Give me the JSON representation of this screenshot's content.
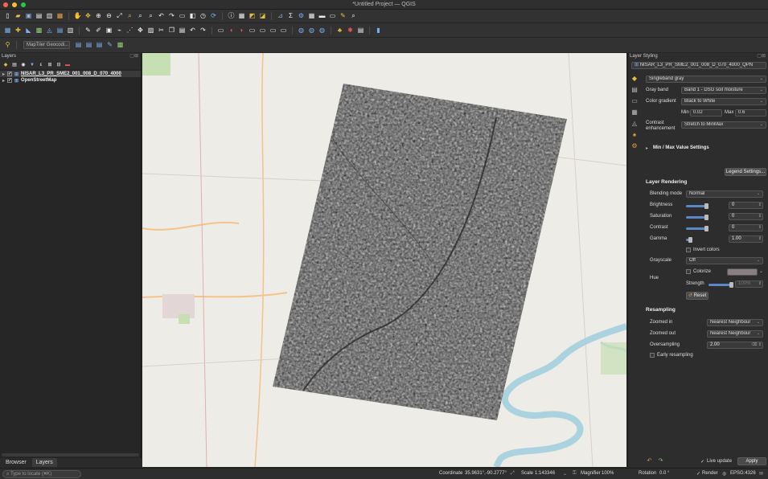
{
  "window": {
    "title": "*Untitled Project — QGIS"
  },
  "toolbar": {
    "geocoder_label": "MapTiler Geocodi..."
  },
  "layers_panel": {
    "title": "Layers",
    "items": [
      {
        "name": "NISAR_L3_PR_SME2_001_008_D_070_4000",
        "checked": "✓"
      },
      {
        "name": "OpenStreetMap",
        "checked": "✓"
      }
    ]
  },
  "bottom_tabs": [
    "Browser",
    "Layers"
  ],
  "styling": {
    "title": "Layer Styling",
    "layer_select": "NISAR_L3_PR_SME2_001_008_D_070_4000_QPN",
    "renderer": "Singleband gray",
    "gray_band_label": "Gray band",
    "gray_band_value": "Band 1 - DSG soil moisture",
    "color_gradient_label": "Color gradient",
    "color_gradient_value": "Black to White",
    "min_label": "Min",
    "min_value": "0.02",
    "max_label": "Max",
    "max_value": "0.6",
    "contrast_label_1": "Contrast",
    "contrast_label_2": "enhancement",
    "contrast_value": "Stretch to MinMax",
    "minmax_settings": "Min / Max Value Settings",
    "legend_settings": "Legend Settings...",
    "layer_rendering": "Layer Rendering",
    "blending_label": "Blending mode",
    "blending_value": "Normal",
    "brightness_label": "Brightness",
    "brightness_value": "0",
    "brightness_level": 0.5,
    "saturation_label": "Saturation",
    "saturation_value": "0",
    "saturation_level": 0.5,
    "contrast2_label": "Contrast",
    "contrast2_value": "0",
    "contrast2_level": 0.5,
    "gamma_label": "Gamma",
    "gamma_value": "1.00",
    "gamma_level": 0.1,
    "invert_label": "Invert colors",
    "grayscale_label": "Grayscale",
    "grayscale_value": "Off",
    "hue_label": "Hue",
    "colorize_label": "Colorize",
    "strength_label": "Strength",
    "strength_value": "100%",
    "reset_label": "Reset",
    "resampling": "Resampling",
    "zoomed_in_label": "Zoomed in",
    "zoomed_in_value": "Nearest Neighbour",
    "zoomed_out_label": "Zoomed out",
    "zoomed_out_value": "Nearest Neighbour",
    "oversampling_label": "Oversampling",
    "oversampling_value": "2.00",
    "early_resampling_label": "Early resampling",
    "live_update_label": "Live update",
    "apply_label": "Apply"
  },
  "statusbar": {
    "locate_placeholder": "Type to locate (⌘K)",
    "coordinate_label": "Coordinate",
    "coordinate_value": "35.9631°,-90.2777°",
    "scale_label": "Scale",
    "scale_value": "1:143346",
    "magnifier_label": "Magnifier",
    "magnifier_value": "100%",
    "rotation_label": "Rotation",
    "rotation_value": "0.0 °",
    "render_label": "Render",
    "crs_value": "EPSG:4326"
  },
  "colors": {
    "accent": "#5b87c5",
    "map_bg": "#eeece6",
    "water": "#aad3df",
    "raster_dark": "#4a4a4a"
  }
}
